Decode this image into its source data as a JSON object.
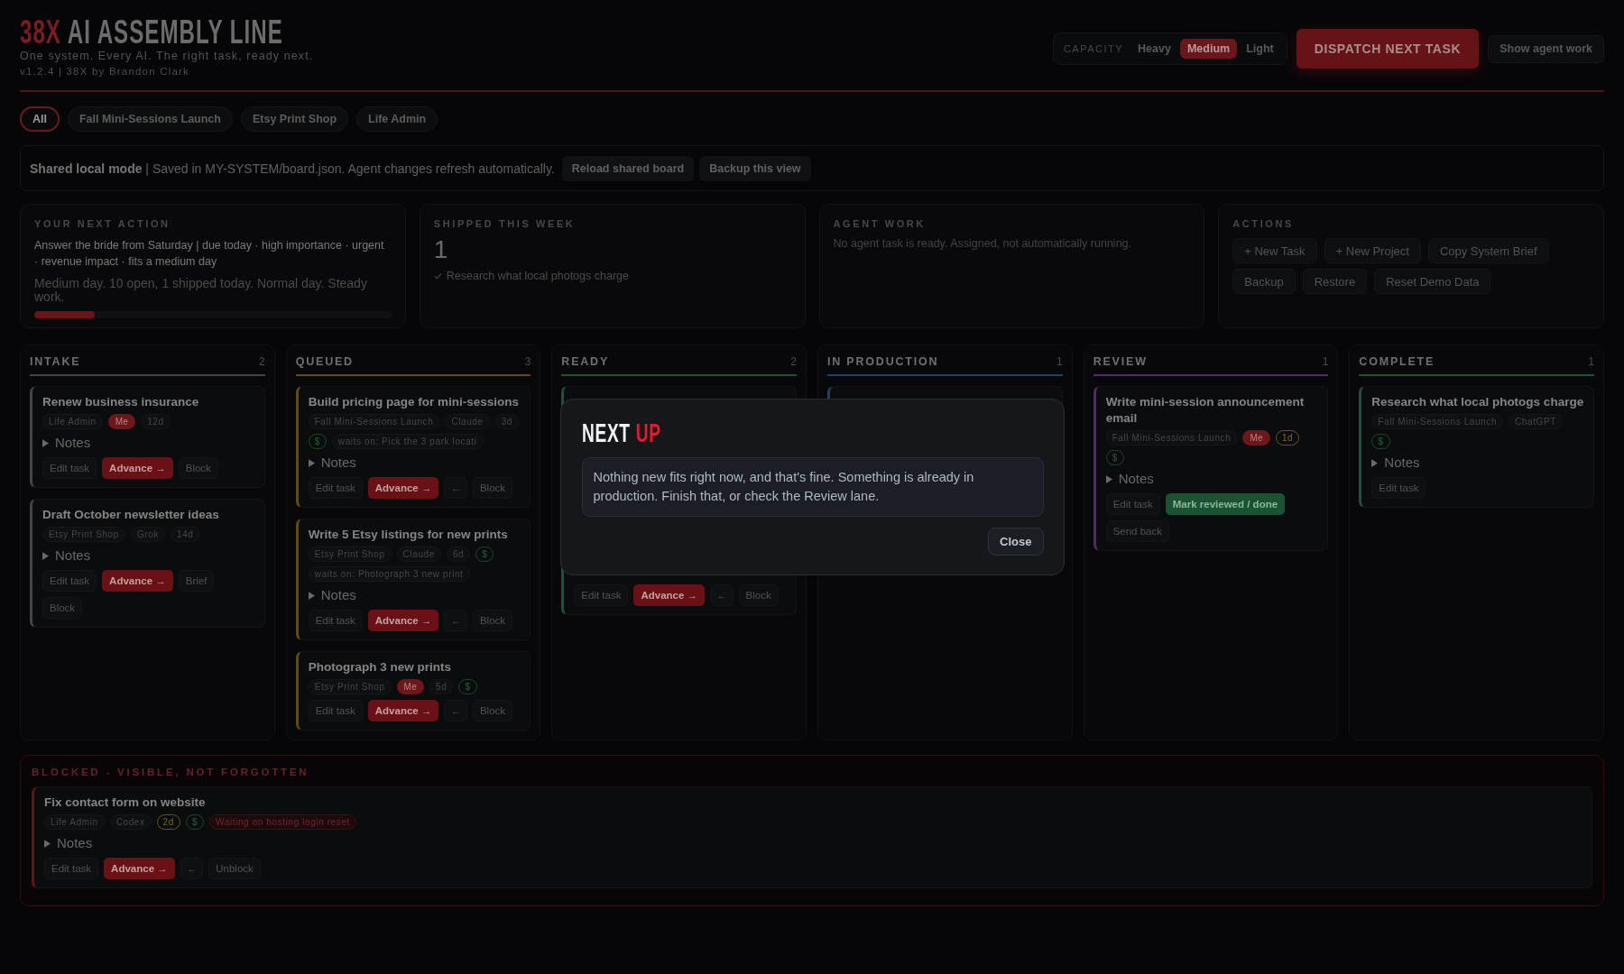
{
  "header": {
    "brand": "38X",
    "title": "AI ASSEMBLY LINE",
    "tagline": "One system. Every AI. The right task, ready next.",
    "version": "v1.2.4 | 38X by Brandon Clark",
    "capacity": {
      "label": "CAPACITY",
      "options": [
        {
          "label": "Heavy",
          "selected": false
        },
        {
          "label": "Medium",
          "selected": true
        },
        {
          "label": "Light",
          "selected": false
        }
      ]
    },
    "dispatch_button": "DISPATCH NEXT TASK",
    "agent_button": "Show agent work"
  },
  "filters": [
    {
      "label": "All",
      "selected": true
    },
    {
      "label": "Fall Mini-Sessions Launch",
      "selected": false
    },
    {
      "label": "Etsy Print Shop",
      "selected": false
    },
    {
      "label": "Life Admin",
      "selected": false
    }
  ],
  "shared_bar": {
    "text": "**Shared local mode** | Saved in MY-SYSTEM/board.json. Agent changes refresh automatically.",
    "buttons": [
      "Reload shared board",
      "Backup this view"
    ]
  },
  "stats": [
    {
      "kind": "next_action",
      "label": "YOUR NEXT ACTION",
      "text": "Answer the bride from Saturday | due today · high importance · urgent · revenue impact · fits a medium day",
      "note": "Medium day. 10 open, 1 shipped today. Normal day. Steady work.",
      "level": 0.17
    },
    {
      "kind": "shipped",
      "label": "SHIPPED THIS WEEK",
      "count": "1",
      "items": [
        "Research what local photogs charge"
      ]
    },
    {
      "kind": "agent",
      "label": "AGENT WORK",
      "text": "No agent task is ready. Assigned, not automatically running."
    },
    {
      "kind": "actions",
      "label": "ACTIONS",
      "buttons": [
        "+ New Task",
        "+ New Project",
        "Copy System Brief",
        "Backup",
        "Restore",
        "Reset Demo Data"
      ]
    }
  ],
  "columns": [
    {
      "name": "INTAKE",
      "count": "2",
      "color": "#434448",
      "cards": [
        {
          "title": "Renew business insurance",
          "tags": [
            {
              "kind": "plain",
              "text": "Life Admin"
            },
            {
              "kind": "me",
              "text": "Me"
            },
            {
              "kind": "plain",
              "text": "12d"
            }
          ],
          "notes": {
            "label": "Notes",
            "expanded": false
          },
          "buttons": [
            {
              "kind": "plain",
              "label": "Edit task"
            },
            {
              "kind": "advance",
              "label": "Advance →"
            },
            {
              "kind": "plain",
              "label": "Block"
            }
          ]
        },
        {
          "title": "Draft October newsletter ideas",
          "tags": [
            {
              "kind": "plain",
              "text": "Etsy Print Shop"
            },
            {
              "kind": "plain",
              "text": "Grok"
            },
            {
              "kind": "plain",
              "text": "14d"
            }
          ],
          "notes": {
            "label": "Notes",
            "expanded": false
          },
          "buttons": [
            {
              "kind": "plain",
              "label": "Edit task"
            },
            {
              "kind": "advance",
              "label": "Advance →"
            },
            {
              "kind": "plain",
              "label": "Brief"
            },
            {
              "kind": "plain",
              "label": "Block"
            }
          ]
        }
      ]
    },
    {
      "name": "QUEUED",
      "count": "3",
      "color": "#5e4c18",
      "cards": [
        {
          "title": "Build pricing page for mini-sessions",
          "tags": [
            {
              "kind": "plain",
              "text": "Fall Mini-Sessions Launch"
            },
            {
              "kind": "plain",
              "text": "Claude"
            },
            {
              "kind": "plain",
              "text": "3d"
            },
            {
              "kind": "money",
              "text": "$"
            },
            {
              "kind": "plain",
              "text": "waits on: Pick the 3 park locati"
            }
          ],
          "notes": {
            "label": "Notes",
            "expanded": false
          },
          "buttons": [
            {
              "kind": "plain",
              "label": "Edit task"
            },
            {
              "kind": "advance",
              "label": "Advance →"
            },
            {
              "kind": "back",
              "label": "←"
            },
            {
              "kind": "plain",
              "label": "Block"
            }
          ]
        },
        {
          "title": "Write 5 Etsy listings for new prints",
          "tags": [
            {
              "kind": "plain",
              "text": "Etsy Print Shop"
            },
            {
              "kind": "plain",
              "text": "Claude"
            },
            {
              "kind": "plain",
              "text": "6d"
            },
            {
              "kind": "money",
              "text": "$"
            },
            {
              "kind": "plain",
              "text": "waits on: Photograph 3 new print"
            }
          ],
          "notes": {
            "label": "Notes",
            "expanded": false
          },
          "buttons": [
            {
              "kind": "plain",
              "label": "Edit task"
            },
            {
              "kind": "advance",
              "label": "Advance →"
            },
            {
              "kind": "back",
              "label": "←"
            },
            {
              "kind": "plain",
              "label": "Block"
            }
          ]
        },
        {
          "title": "Photograph 3 new prints",
          "tags": [
            {
              "kind": "plain",
              "text": "Etsy Print Shop"
            },
            {
              "kind": "me",
              "text": "Me"
            },
            {
              "kind": "plain",
              "text": "5d"
            },
            {
              "kind": "money",
              "text": "$"
            }
          ],
          "buttons": [
            {
              "kind": "plain",
              "label": "Edit task"
            },
            {
              "kind": "advance",
              "label": "Advance →"
            },
            {
              "kind": "back",
              "label": "←"
            },
            {
              "kind": "plain",
              "label": "Block"
            }
          ]
        }
      ]
    },
    {
      "name": "READY",
      "count": "2",
      "color": "#22503a",
      "cards": [
        {
          "obscured": true,
          "buttons": [
            {
              "kind": "plain",
              "label": "Edit task"
            },
            {
              "kind": "advance",
              "label": "Advance →"
            },
            {
              "kind": "back",
              "label": "←"
            },
            {
              "kind": "plain",
              "label": "Block"
            }
          ]
        }
      ]
    },
    {
      "name": "IN PRODUCTION",
      "count": "1",
      "color": "#243f66",
      "cards": [
        {
          "obscured": true
        }
      ]
    },
    {
      "name": "REVIEW",
      "count": "1",
      "color": "#4f2c62",
      "cards": [
        {
          "title": "Write mini-session announcement email",
          "tags": [
            {
              "kind": "plain",
              "text": "Fall Mini-Sessions Launch"
            },
            {
              "kind": "me",
              "text": "Me"
            },
            {
              "kind": "warn",
              "text": "1d"
            },
            {
              "kind": "money",
              "text": "$"
            }
          ],
          "notes": {
            "label": "Notes",
            "expanded": false
          },
          "buttons": [
            {
              "kind": "plain",
              "label": "Edit task"
            },
            {
              "kind": "done",
              "label": "Mark reviewed / done"
            },
            {
              "kind": "plain",
              "label": "Send back"
            }
          ]
        }
      ]
    },
    {
      "name": "COMPLETE",
      "count": "1",
      "color": "#22503a",
      "cards": [
        {
          "title": "Research what local photogs charge",
          "tags": [
            {
              "kind": "plain",
              "text": "Fall Mini-Sessions Launch"
            },
            {
              "kind": "plain",
              "text": "ChatGPT"
            },
            {
              "kind": "money",
              "text": "$"
            }
          ],
          "notes": {
            "label": "Notes",
            "expanded": false
          },
          "buttons": [
            {
              "kind": "plain",
              "label": "Edit task"
            }
          ]
        }
      ]
    }
  ],
  "blocked": {
    "title": "BLOCKED - VISIBLE, NOT FORGOTTEN",
    "cards": [
      {
        "title": "Fix contact form on website",
        "tags": [
          {
            "kind": "plain",
            "text": "Life Admin"
          },
          {
            "kind": "plain",
            "text": "Codex"
          },
          {
            "kind": "warn",
            "text": "2d"
          },
          {
            "kind": "money",
            "text": "$"
          },
          {
            "kind": "blocker",
            "text": "Waiting on hosting login reset"
          }
        ],
        "notes": {
          "label": "Notes",
          "expanded": false
        },
        "buttons": [
          {
            "kind": "plain",
            "label": "Edit task"
          },
          {
            "kind": "advance",
            "label": "Advance →"
          },
          {
            "kind": "back",
            "label": "←"
          },
          {
            "kind": "plain",
            "label": "Unblock"
          }
        ]
      }
    ]
  },
  "dialog": {
    "title": "NEXT",
    "title_accent": "UP",
    "message": "Nothing new fits right now, and that's fine. Something is already in production. Finish that, or check the Review lane.",
    "button": "Close"
  }
}
